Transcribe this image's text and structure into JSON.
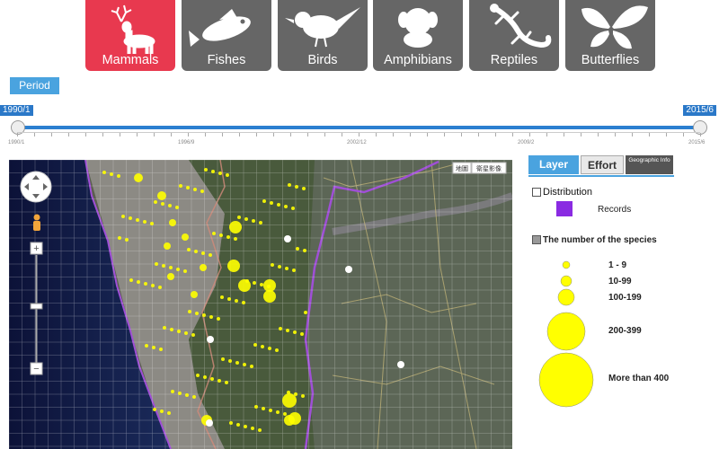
{
  "tabs": [
    {
      "label": "Mammals",
      "icon": "deer-icon",
      "active": true
    },
    {
      "label": "Fishes",
      "icon": "fish-icon",
      "active": false
    },
    {
      "label": "Birds",
      "icon": "bird-icon",
      "active": false
    },
    {
      "label": "Amphibians",
      "icon": "frog-icon",
      "active": false
    },
    {
      "label": "Reptiles",
      "icon": "lizard-icon",
      "active": false
    },
    {
      "label": "Butterflies",
      "icon": "butterfly-icon",
      "active": false
    }
  ],
  "colors": {
    "active_tab": "#e8394f",
    "inactive_tab": "#666666",
    "accent": "#4aa3df",
    "slider": "#2b7fd0",
    "distribution": "#8a2be2",
    "circle": "#ffff00"
  },
  "period": {
    "button_label": "Period",
    "start_flag": "1990/1",
    "end_flag": "2015/6",
    "tick_labels": [
      "1990/1",
      "1996/9",
      "2002/12",
      "2009/2",
      "2015/6"
    ]
  },
  "map": {
    "type_buttons": [
      "地圖",
      "衛星影像"
    ]
  },
  "panel": {
    "tabs": [
      "Layer",
      "Effort",
      "Geographic Info"
    ],
    "distribution_label": "Distribution",
    "distribution_checked": false,
    "records_label": "Records",
    "species_label": "The number of the species",
    "species_checked": true,
    "legend": [
      {
        "label": "1 - 9"
      },
      {
        "label": "10-99"
      },
      {
        "label": "100-199"
      },
      {
        "label": "200-399"
      },
      {
        "label": "More than 400"
      }
    ]
  }
}
